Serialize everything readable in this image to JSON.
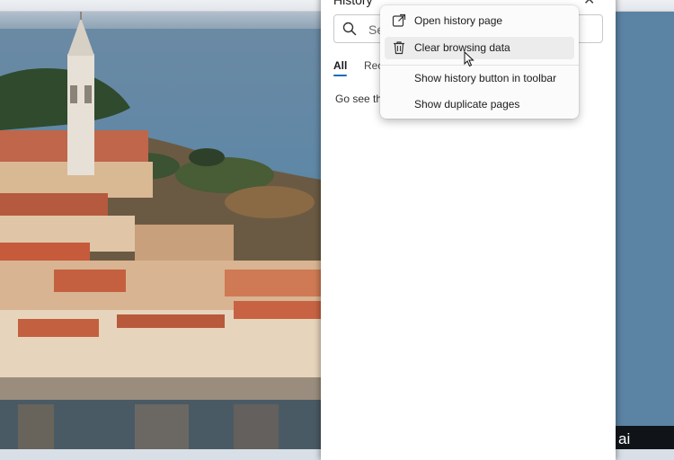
{
  "panel": {
    "title": "History",
    "close_glyph": "✕",
    "search_placeholder": "Search history",
    "tabs": [
      {
        "label": "All",
        "active": true
      },
      {
        "label": "Recently closed",
        "active": false
      }
    ],
    "hint": "Go see the sites you've visited"
  },
  "menu": {
    "items": [
      {
        "label": "Open history page",
        "icon": "external-link-icon"
      },
      {
        "label": "Clear browsing data",
        "icon": "trash-icon",
        "hovered": true
      },
      {
        "label": "Show history button in toolbar",
        "icon": ""
      },
      {
        "label": "Show duplicate pages",
        "icon": ""
      }
    ]
  },
  "corner_text": "ai",
  "colors": {
    "accent": "#0f6cbd",
    "menu_hover": "#ececec",
    "panel_bg": "#ffffff"
  }
}
